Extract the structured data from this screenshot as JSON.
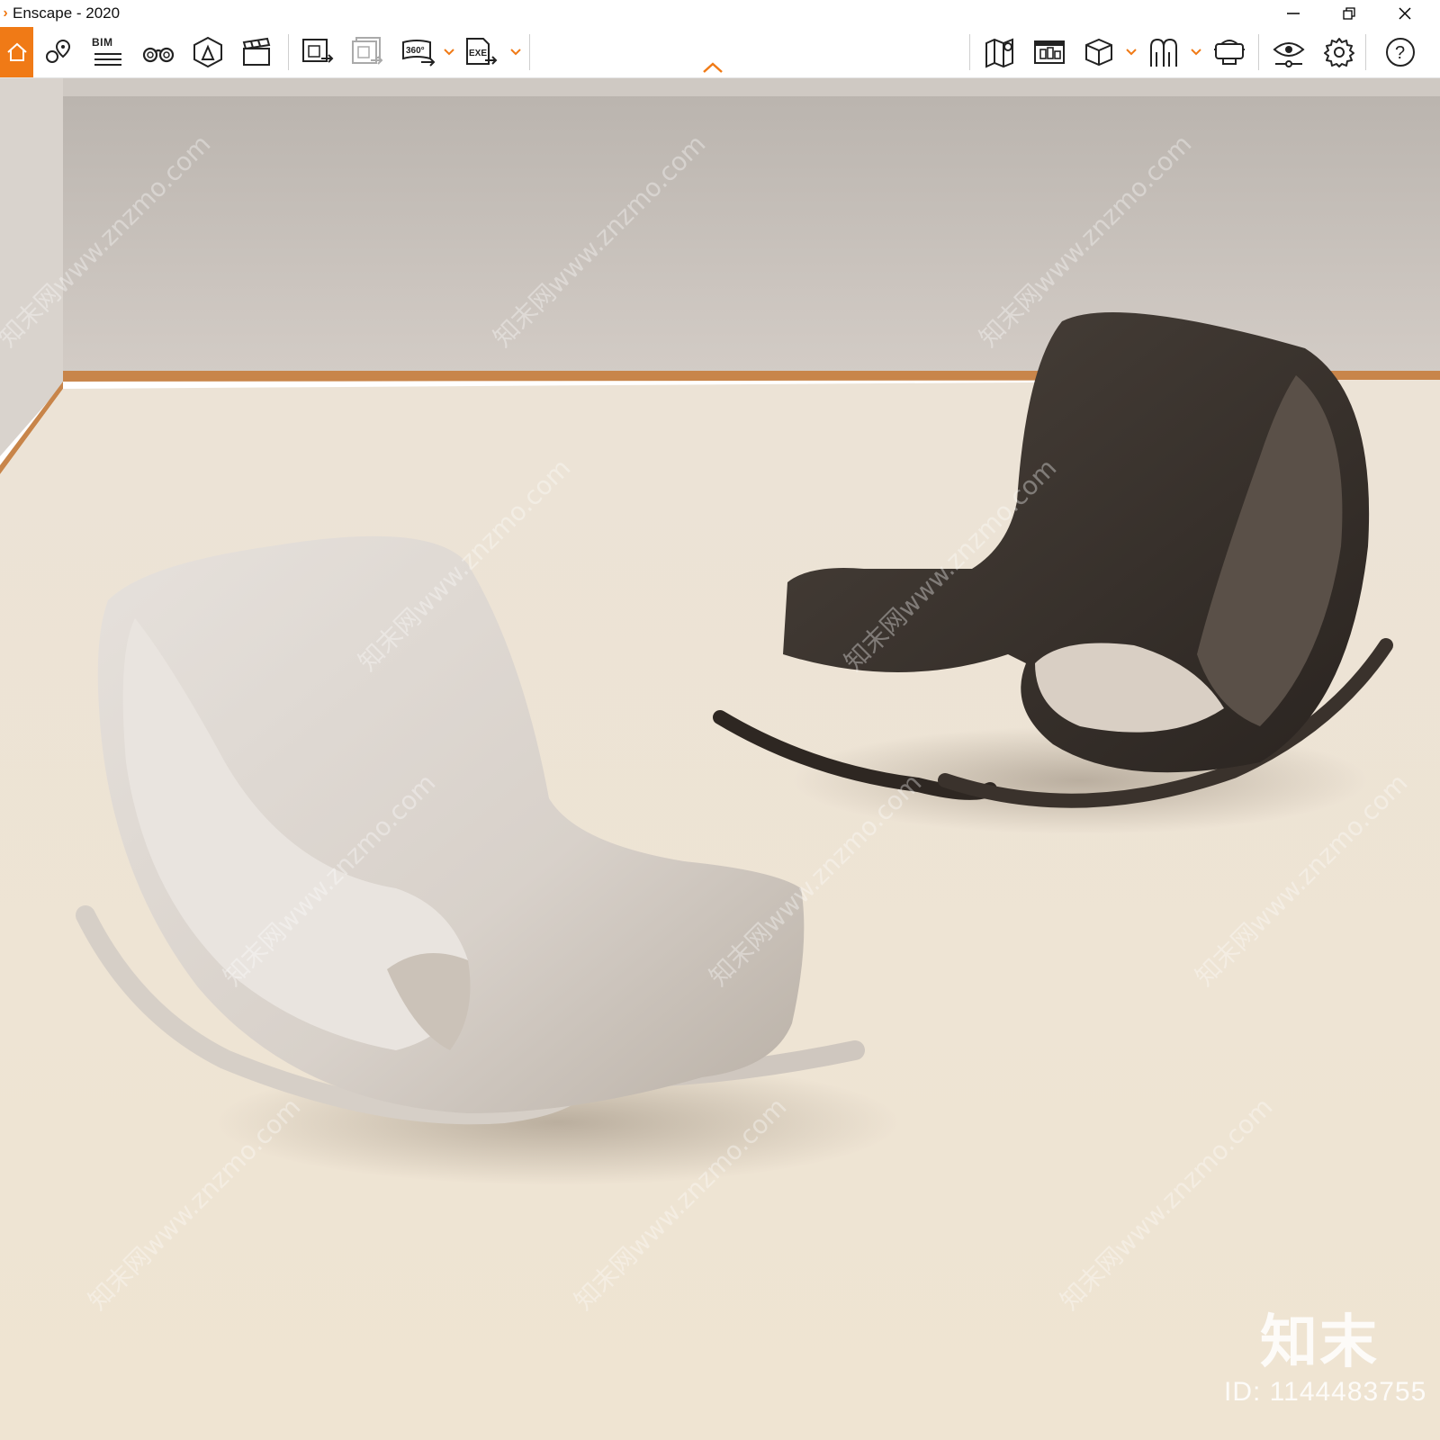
{
  "window": {
    "title": "Enscape - 2020",
    "controls": [
      "minimize-icon",
      "restore-icon",
      "close-icon"
    ]
  },
  "toolbar": {
    "accent_color": "#f07a16",
    "left_buttons": [
      {
        "id": "home",
        "icon": "home-icon"
      },
      {
        "id": "views",
        "icon": "map-pin-icon"
      },
      {
        "id": "bim",
        "icon": "bim-list-icon",
        "label": "BIM"
      },
      {
        "id": "binoculars",
        "icon": "binoculars-icon"
      },
      {
        "id": "assets",
        "icon": "asset-library-icon"
      },
      {
        "id": "video",
        "icon": "clapperboard-icon"
      },
      {
        "id": "export-image",
        "icon": "export-image-icon"
      },
      {
        "id": "batch-export",
        "icon": "batch-export-icon"
      },
      {
        "id": "panorama",
        "icon": "panorama-360-icon",
        "label": "360°"
      },
      {
        "id": "exe",
        "icon": "export-exe-icon",
        "label": "EXE"
      }
    ],
    "right_buttons": [
      {
        "id": "map",
        "icon": "map-icon"
      },
      {
        "id": "export-web",
        "icon": "web-standalone-icon"
      },
      {
        "id": "box",
        "icon": "cube-icon"
      },
      {
        "id": "collab",
        "icon": "collaborate-icon"
      },
      {
        "id": "vr",
        "icon": "vr-headset-icon"
      },
      {
        "id": "visual-settings",
        "icon": "eye-settings-icon"
      },
      {
        "id": "settings",
        "icon": "gear-icon"
      },
      {
        "id": "help",
        "icon": "help-icon",
        "label": "?"
      }
    ]
  },
  "viewport": {
    "watermark_text": "知末网www.znzmo.com",
    "brand": "知末",
    "id_label": "ID: 1144483755"
  }
}
